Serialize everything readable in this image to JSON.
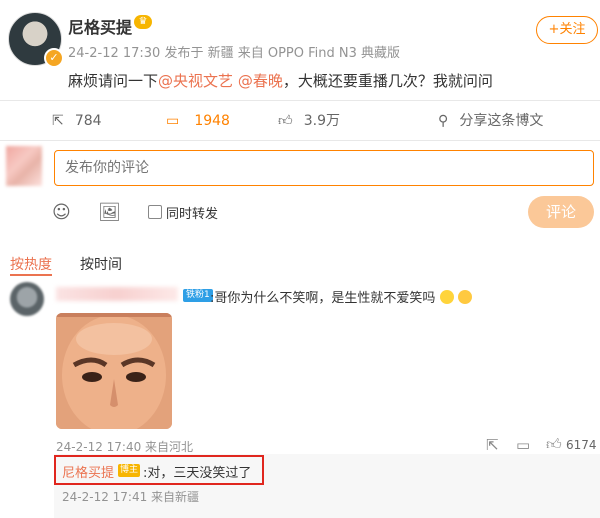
{
  "post": {
    "author": "尼格买提",
    "meta": "24-2-12 17:30 发布于 新疆 来自 OPPO Find N3 典藏版",
    "follow_label": "+关注",
    "text_prefix": "麻烦请问一下",
    "mention1": "@央视文艺",
    "mention2": "@春晚",
    "text_suffix": "，大概还要重播几次？我就问问"
  },
  "actions": {
    "forward_count": "784",
    "comment_count": "1948",
    "like_count": "3.9万",
    "share_label": "分享这条博文"
  },
  "composer": {
    "placeholder": "发布你的评论",
    "repost_label": "同时转发",
    "submit_label": "评论"
  },
  "sort": {
    "hot_label": "按热度",
    "time_label": "按时间"
  },
  "comment": {
    "fan_badge": "铁粉1",
    "text": ":哥你为什么不笑啊，是生性就不爱笑吗",
    "meta": "24-2-12 17:40 来自河北",
    "like_count": "6174"
  },
  "reply": {
    "author": "尼格买提",
    "badge": "博主",
    "text": ":对，三天没笑过了",
    "meta": "24-2-12 17:41 来自新疆"
  },
  "colors": {
    "accent": "#ff8200",
    "link": "#eb7350",
    "highlight_box": "#e0261e"
  }
}
